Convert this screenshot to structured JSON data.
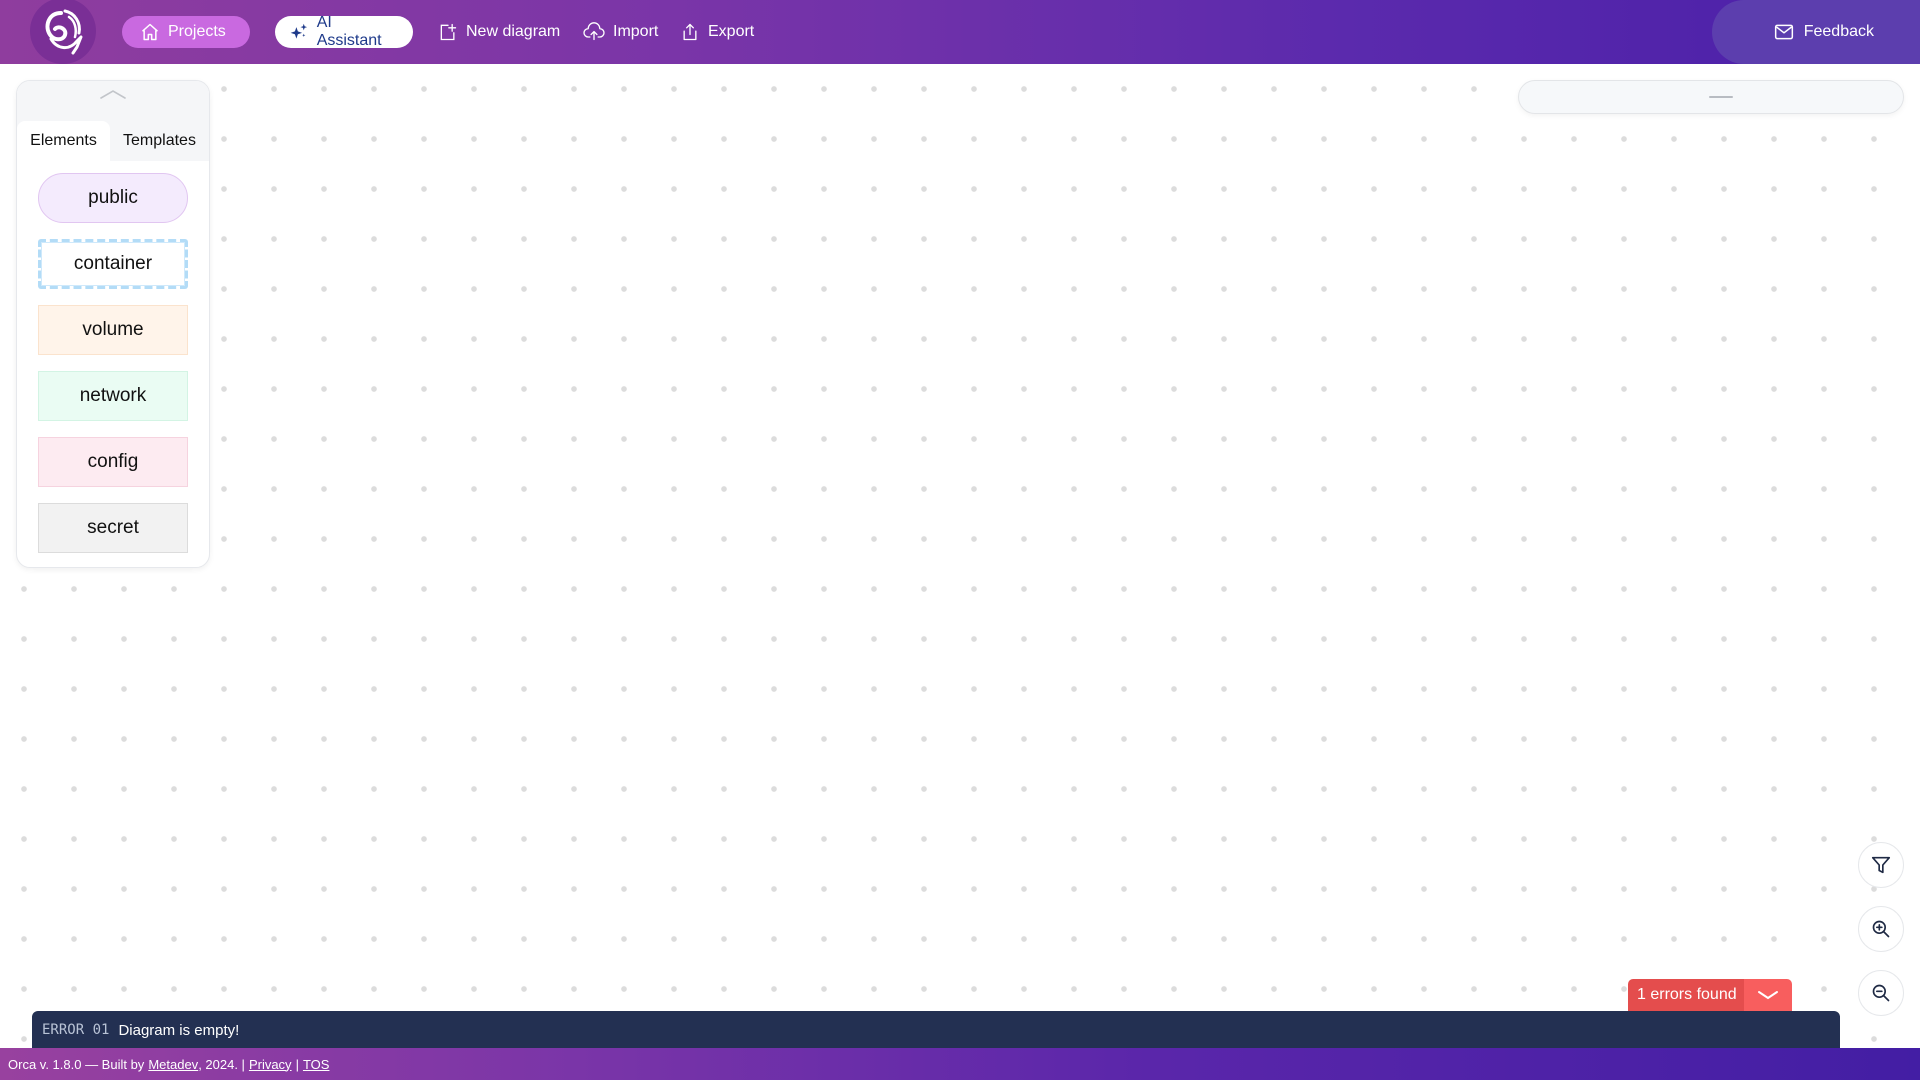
{
  "header": {
    "logo_alt": "Orca logo",
    "nav": {
      "projects": "Projects",
      "ai_assistant": "AI Assistant",
      "new_diagram": "New diagram",
      "import": "Import",
      "export": "Export"
    },
    "feedback": "Feedback"
  },
  "palette": {
    "tabs": [
      {
        "label": "Elements",
        "active": true
      },
      {
        "label": "Templates",
        "active": false
      }
    ],
    "elements": [
      {
        "label": "public",
        "color": "#f4ebfd"
      },
      {
        "label": "container",
        "color": "#ffffff"
      },
      {
        "label": "volume",
        "color": "#fff4ea"
      },
      {
        "label": "network",
        "color": "#eafcf3"
      },
      {
        "label": "config",
        "color": "#fdebf1"
      },
      {
        "label": "secret",
        "color": "#f2f2f2"
      }
    ]
  },
  "errors": {
    "summary": "1 errors found",
    "items": [
      {
        "code": "ERROR 01",
        "message": "Diagram is empty!"
      }
    ]
  },
  "footer": {
    "prefix": "Orca v. 1.8.0 — Built by",
    "author_link": "Metadev",
    "year": ", 2024. |",
    "privacy_link": "Privacy",
    "separator": "|",
    "tos_link": "TOS"
  },
  "colors": {
    "brand_purple": "#7a35a8",
    "ai_text": "#1e3a8a",
    "error_red": "#e44d4d",
    "error_bar": "#233052"
  }
}
